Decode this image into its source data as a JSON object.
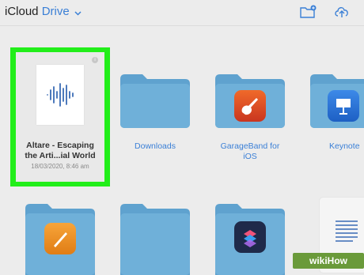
{
  "header": {
    "app_name": "iCloud",
    "location": "Drive",
    "new_folder_icon": "folder-badge-plus-icon",
    "upload_icon": "cloud-upload-icon"
  },
  "items": [
    {
      "name": "Altare - Escaping the Arti...ial World",
      "line1": "Altare - Escaping",
      "line2": "the Arti...ial World",
      "date": "18/03/2020, 8:46 am",
      "kind": "audio-file",
      "selected": true
    },
    {
      "name": "Downloads",
      "kind": "folder"
    },
    {
      "name": "GarageBand for iOS",
      "line1": "GarageBand for",
      "line2": "iOS",
      "kind": "app-folder",
      "app": "garageband-icon"
    },
    {
      "name": "Keynote",
      "kind": "app-folder",
      "app": "keynote-icon"
    },
    {
      "name": "",
      "kind": "app-folder",
      "app": "pages-icon"
    },
    {
      "name": "",
      "kind": "folder"
    },
    {
      "name": "",
      "kind": "app-folder",
      "app": "shortcuts-icon"
    },
    {
      "name": "",
      "kind": "document"
    }
  ],
  "colors": {
    "folder": "#6fb0d9",
    "folder_tab": "#5fa2cf",
    "highlight": "#22ee1a",
    "accent": "#3a7fd6"
  },
  "watermark": "wikiHow"
}
